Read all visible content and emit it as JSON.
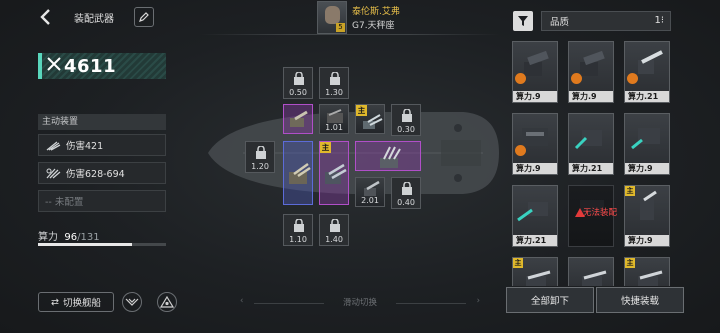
{
  "header": {
    "title": "装配武器"
  },
  "power": {
    "value": "4611"
  },
  "active_equipment": {
    "label": "主动装置",
    "items": [
      {
        "label": "伤害421",
        "icon": "claw-strike-icon"
      },
      {
        "label": "伤害628-694",
        "icon": "claw-burst-icon"
      },
      {
        "label": "-- 未配置",
        "icon": ""
      }
    ]
  },
  "compute": {
    "label": "算力",
    "current": "96",
    "max": "/131",
    "fraction": 0.733
  },
  "buttons": {
    "switch_ship": "切换舰船",
    "swipe_hint": "滑动切换",
    "unequip_all": "全部卸下",
    "quick_equip": "快捷装载"
  },
  "commander": {
    "name": "泰伦斯.艾弗",
    "location": "G7.天秤座",
    "level": "5"
  },
  "slots": {
    "a": "0.50",
    "b": "1.30",
    "c": "1.01",
    "d": "0.30",
    "e": "1.20",
    "f": "2.01",
    "g": "0.40",
    "h": "1.10",
    "i": "1.40",
    "badge": "主"
  },
  "filter": {
    "quality_label": "品质"
  },
  "cards": {
    "c1": "算力.9",
    "c2": "算力.9",
    "c3": "算力.21",
    "c4": "算力.9",
    "c5": "算力.21",
    "c6": "算力.9",
    "c7": "算力.21",
    "c8": "无法装配",
    "c9": "算力.9",
    "badge": "主"
  },
  "colors": {
    "power_accent": "#59d6bc",
    "badge_gold": "#e0b92c",
    "slot_blue": "#5c6bd8",
    "slot_purple": "#b04fc8",
    "warning_red": "#ff4b4b"
  }
}
